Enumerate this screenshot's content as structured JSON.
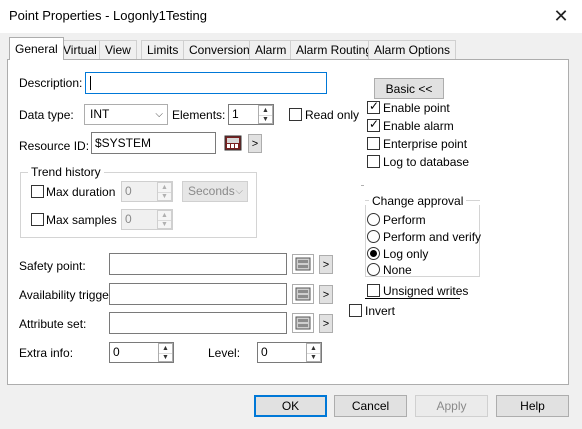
{
  "window": {
    "title": "Point Properties - Logonly1Testing"
  },
  "tabs": [
    "General",
    "Virtual",
    "View",
    "Limits",
    "Conversion",
    "Alarm",
    "Alarm Routing",
    "Alarm Options"
  ],
  "general": {
    "description_label": "Description:",
    "description_value": "",
    "data_type_label": "Data type:",
    "data_type_value": "INT",
    "elements_label": "Elements:",
    "elements_value": "1",
    "read_only_label": "Read only",
    "resource_id_label": "Resource ID:",
    "resource_id_value": "$SYSTEM",
    "browse_arrow": ">",
    "trend_history_label": "Trend history",
    "max_duration_label": "Max duration",
    "max_duration_value": "0",
    "duration_unit": "Seconds",
    "max_samples_label": "Max samples",
    "max_samples_value": "0",
    "safety_point_label": "Safety point:",
    "availability_trigger_label": "Availability trigger:",
    "attribute_set_label": "Attribute set:",
    "extra_info_label": "Extra info:",
    "extra_info_value": "0",
    "level_label": "Level:",
    "level_value": "0",
    "basic_button": "Basic <<",
    "enable_point_label": "Enable point",
    "enable_alarm_label": "Enable alarm",
    "enterprise_point_label": "Enterprise point",
    "log_to_database_label": "Log to database",
    "change_approval_label": "Change approval",
    "perform_label": "Perform",
    "perform_verify_label": "Perform and verify",
    "log_only_label": "Log only",
    "none_label": "None",
    "unsigned_writes_label": "Unsigned writes",
    "invert_label": "Invert"
  },
  "footer": {
    "ok": "OK",
    "cancel": "Cancel",
    "apply": "Apply",
    "help": "Help"
  }
}
